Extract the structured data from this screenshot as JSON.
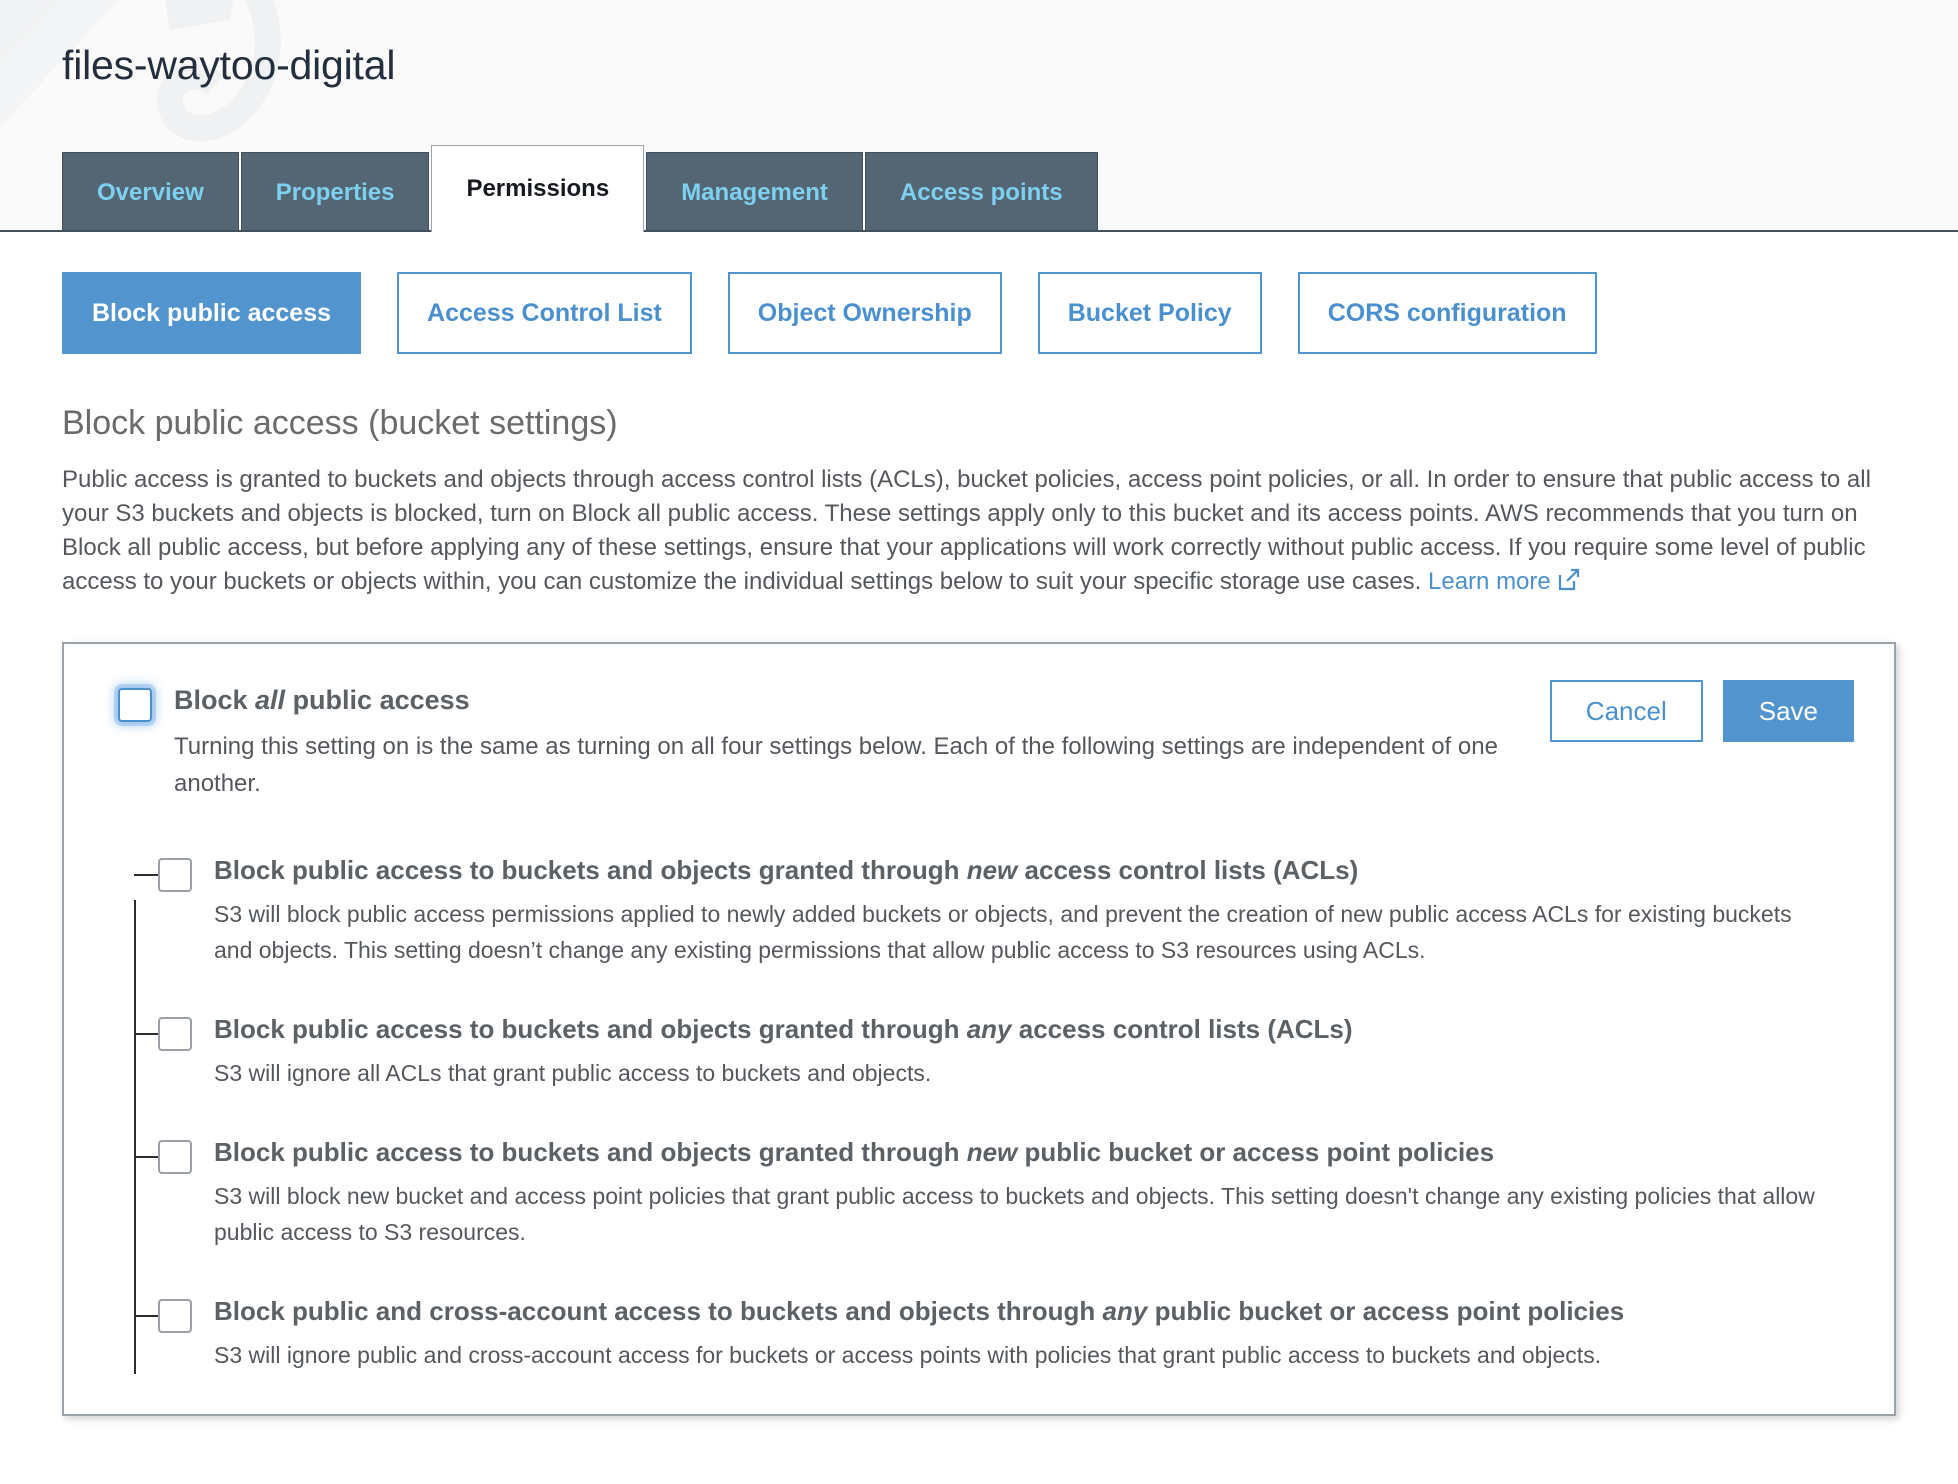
{
  "header": {
    "bucket_name": "files-waytoo-digital",
    "tabs": [
      {
        "label": "Overview",
        "active": false
      },
      {
        "label": "Properties",
        "active": false
      },
      {
        "label": "Permissions",
        "active": true
      },
      {
        "label": "Management",
        "active": false
      },
      {
        "label": "Access points",
        "active": false
      }
    ]
  },
  "subnav": {
    "items": [
      {
        "label": "Block public access",
        "active": true
      },
      {
        "label": "Access Control List",
        "active": false
      },
      {
        "label": "Object Ownership",
        "active": false
      },
      {
        "label": "Bucket Policy",
        "active": false
      },
      {
        "label": "CORS configuration",
        "active": false
      }
    ]
  },
  "section": {
    "title": "Block public access (bucket settings)",
    "description_part1": "Public access is granted to buckets and objects through access control lists (ACLs), bucket policies, access point policies, or all. In order to ensure that public access to all your S3 buckets and objects is blocked, turn on Block all public access. These settings apply only to this bucket and its access points. AWS recommends that you turn on Block all public access, but before applying any of these settings, ensure that your applications will work correctly without public access. If you require some level of public access to your buckets or objects within, you can customize the individual settings below to suit your specific storage use cases. ",
    "learn_more_label": "Learn more"
  },
  "panel": {
    "master": {
      "title_prefix": "Block ",
      "title_emphasis": "all",
      "title_suffix": " public access",
      "description": "Turning this setting on is the same as turning on all four settings below. Each of the following settings are independent of one another.",
      "checked": false
    },
    "buttons": {
      "cancel_label": "Cancel",
      "save_label": "Save"
    },
    "settings": [
      {
        "title_prefix": "Block public access to buckets and objects granted through ",
        "title_emphasis": "new",
        "title_suffix": " access control lists (ACLs)",
        "description": "S3 will block public access permissions applied to newly added buckets or objects, and prevent the creation of new public access ACLs for existing buckets and objects. This setting doesn’t change any existing permissions that allow public access to S3 resources using ACLs.",
        "checked": false
      },
      {
        "title_prefix": "Block public access to buckets and objects granted through ",
        "title_emphasis": "any",
        "title_suffix": " access control lists (ACLs)",
        "description": "S3 will ignore all ACLs that grant public access to buckets and objects.",
        "checked": false
      },
      {
        "title_prefix": "Block public access to buckets and objects granted through ",
        "title_emphasis": "new",
        "title_suffix": " public bucket or access point policies",
        "description": "S3 will block new bucket and access point policies that grant public access to buckets and objects. This setting doesn't change any existing policies that allow public access to S3 resources.",
        "checked": false
      },
      {
        "title_prefix": "Block public and cross-account access to buckets and objects through ",
        "title_emphasis": "any",
        "title_suffix": " public bucket or access point policies",
        "description": "S3 will ignore public and cross-account access for buckets or access points with policies that grant public access to buckets and objects.",
        "checked": false
      }
    ]
  },
  "colors": {
    "accent_blue": "#5194ce",
    "tab_bg": "#546674",
    "tab_link": "#7ed0f0",
    "text_gray": "#54585c"
  }
}
